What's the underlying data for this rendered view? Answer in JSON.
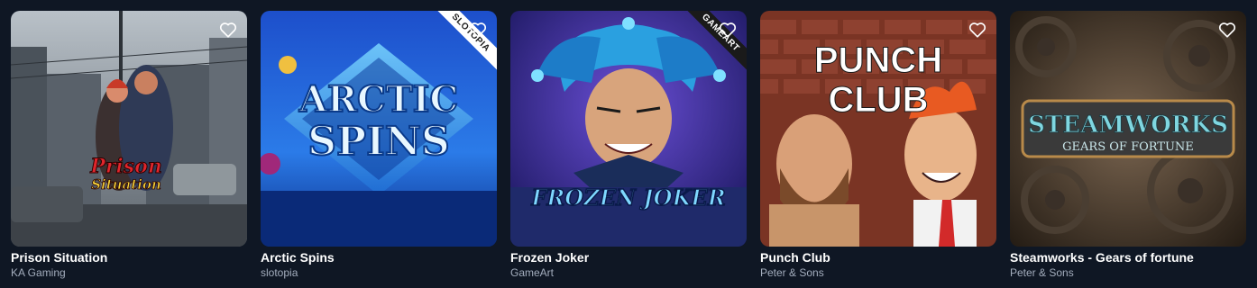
{
  "games": [
    {
      "title": "Prison Situation",
      "provider": "KA Gaming",
      "art_text": "Prison Situation",
      "art_text_line1": "Prison",
      "art_text_line2": "Situation",
      "palette": {
        "bg": "#6d7680",
        "accent": "#e0262c"
      },
      "favorite_icon": "heart-outline-icon"
    },
    {
      "title": "Arctic Spins",
      "provider": "slotopia",
      "art_text_line1": "ARCTIC",
      "art_text_line2": "SPINS",
      "badge": "SLOTOPIA",
      "palette": {
        "bg": "#1f5fd8",
        "accent": "#bfe9ff"
      },
      "favorite_icon": "heart-outline-icon"
    },
    {
      "title": "Frozen Joker",
      "provider": "GameArt",
      "art_text": "FROZEN JOKER",
      "badge": "GAMEART",
      "palette": {
        "bg": "#3a2c8c",
        "accent": "#4cc4ff"
      },
      "favorite_icon": "heart-outline-icon"
    },
    {
      "title": "Punch Club",
      "provider": "Peter & Sons",
      "art_text_line1": "PUNCH",
      "art_text_line2": "CLUB",
      "palette": {
        "bg": "#8c3a2a",
        "accent": "#ffffff"
      },
      "favorite_icon": "heart-outline-icon"
    },
    {
      "title": "Steamworks - Gears of fortune",
      "provider": "Peter & Sons",
      "art_text_line1": "STEAMWORKS",
      "art_text_line2": "GEARS OF FORTUNE",
      "palette": {
        "bg": "#3d3226",
        "accent": "#7fd6e0"
      },
      "favorite_icon": "heart-outline-icon"
    }
  ]
}
